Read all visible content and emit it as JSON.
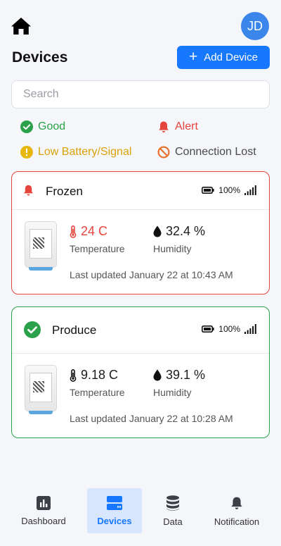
{
  "header": {
    "avatar_initials": "JD"
  },
  "page": {
    "title": "Devices",
    "add_button_label": "Add Device"
  },
  "search": {
    "placeholder": "Search",
    "value": ""
  },
  "legend": {
    "good": "Good",
    "alert": "Alert",
    "low_battery": "Low Battery/Signal",
    "connection_lost": "Connection Lost"
  },
  "colors": {
    "good": "#2aa14a",
    "alert": "#e5453d",
    "warning": "#d9a20b",
    "lost": "#e8722d",
    "accent": "#1677ff"
  },
  "devices": [
    {
      "name": "Frozen",
      "status": "alert",
      "battery": "100%",
      "temperature": "24 C",
      "temperature_label": "Temperature",
      "humidity": "32.4 %",
      "humidity_label": "Humidity",
      "updated": "Last updated January 22 at 10:43 AM"
    },
    {
      "name": "Produce",
      "status": "good",
      "battery": "100%",
      "temperature": "9.18 C",
      "temperature_label": "Temperature",
      "humidity": "39.1 %",
      "humidity_label": "Humidity",
      "updated": "Last updated January 22 at 10:28 AM"
    }
  ],
  "nav": {
    "items": [
      {
        "label": "Dashboard",
        "icon": "bar-chart-icon"
      },
      {
        "label": "Devices",
        "icon": "devices-icon",
        "active": true
      },
      {
        "label": "Data",
        "icon": "database-icon"
      },
      {
        "label": "Notification",
        "icon": "bell-icon"
      }
    ]
  }
}
